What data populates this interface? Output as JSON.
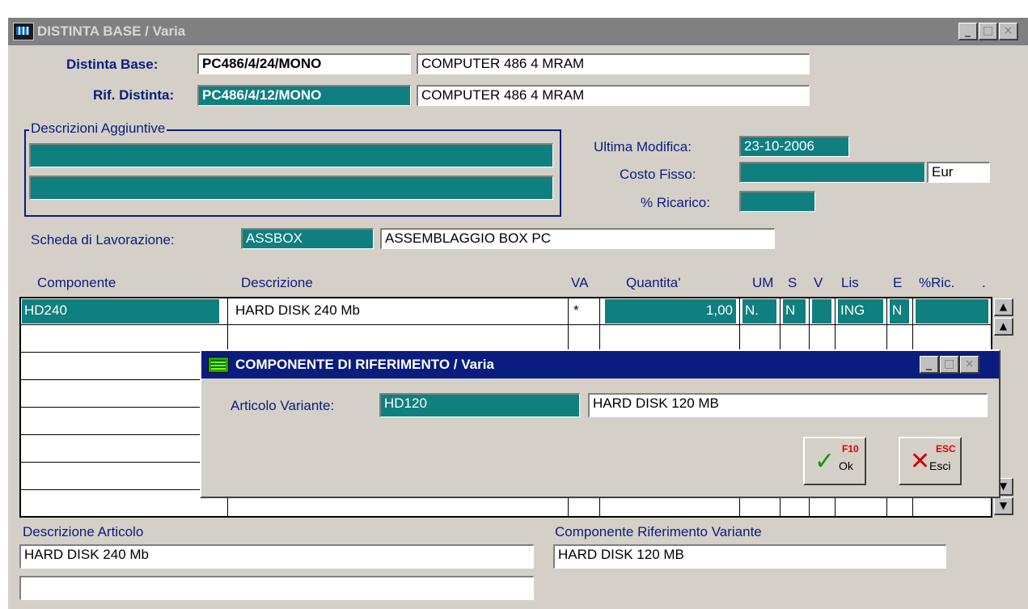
{
  "window": {
    "title": "DISTINTA BASE / Varia",
    "btn_min": "_",
    "btn_max": "□",
    "btn_close": "×"
  },
  "header": {
    "distinta_label": "Distinta Base:",
    "distinta_code": "PC486/4/24/MONO",
    "distinta_desc": "COMPUTER 486 4 MRAM",
    "rif_label": "Rif. Distinta:",
    "rif_code": "PC486/4/12/MONO",
    "rif_desc": "COMPUTER 486 4 MRAM"
  },
  "descr_group": {
    "caption": "Descrizioni Aggiuntive",
    "line1": "",
    "line2": ""
  },
  "info": {
    "ultima_label": "Ultima Modifica:",
    "ultima_value": "23-10-2006",
    "costo_label": "Costo Fisso:",
    "costo_value": "",
    "costo_currency": "Eur",
    "ricarico_label": "% Ricarico:",
    "ricarico_value": ""
  },
  "scheda": {
    "label": "Scheda di Lavorazione:",
    "code": "ASSBOX",
    "desc": "ASSEMBLAGGIO BOX PC"
  },
  "table": {
    "columns": [
      "Componente",
      "Descrizione",
      "VA",
      "Quantita'",
      "UM",
      "S",
      "V",
      "Lis",
      "E",
      "%Ric.",
      "."
    ],
    "rows": [
      {
        "componente": "HD240",
        "descrizione": "HARD DISK 240 Mb",
        "va": "*",
        "quantita": "1,00",
        "um": "N.",
        "s": "N",
        "v": "",
        "lis": "ING",
        "e": "N",
        "ric": ""
      }
    ]
  },
  "scrollbar": {
    "top": "▲",
    "up": "▲",
    "down": "▼",
    "bottom": "▼"
  },
  "footer": {
    "desc_art_label": "Descrizione Articolo",
    "desc_art_value": "HARD DISK 240 Mb",
    "desc_art_value2": "",
    "comp_rif_label": "Componente Riferimento Variante",
    "comp_rif_value": "HARD DISK 120 MB"
  },
  "dialog": {
    "title": "COMPONENTE DI RIFERIMENTO / Varia",
    "articolo_label": "Articolo Variante:",
    "articolo_code": "HD120",
    "articolo_desc": "HARD DISK 120 MB",
    "ok_key": "F10",
    "ok_label": "Ok",
    "esci_key": "ESC",
    "esci_label": "Esci",
    "ok_icon": "✓",
    "esci_icon": "✕"
  },
  "colors": {
    "teal": "#0f7f7f",
    "navy": "#0a1d7e",
    "face": "#d4d0c8"
  }
}
